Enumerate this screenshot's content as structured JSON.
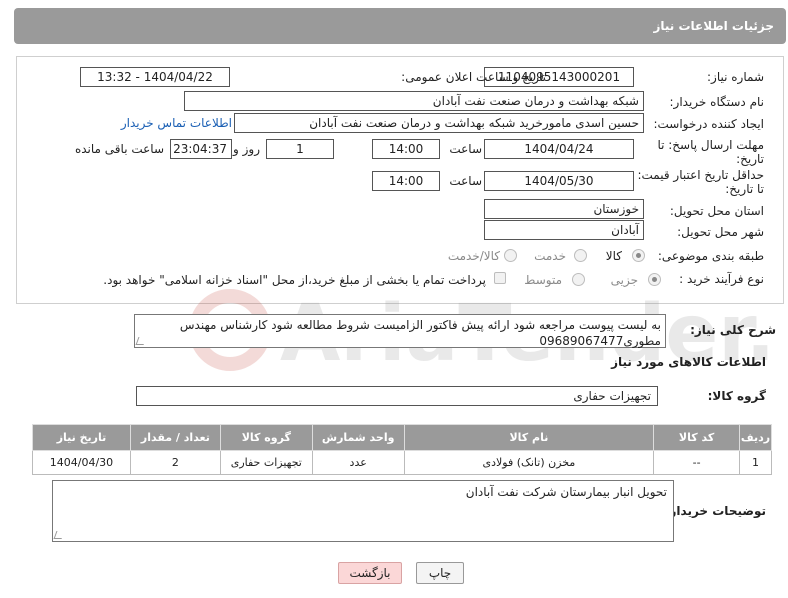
{
  "header": {
    "title": "جزئیات اطلاعات نیاز"
  },
  "form": {
    "need_number_label": "شماره نیاز:",
    "need_number": "1104095143000201",
    "announce_label": "تاریخ و ساعت اعلان عمومی:",
    "announce_value": "1404/04/22 - 13:32",
    "buyer_org_label": "نام دستگاه خریدار:",
    "buyer_org": "شبکه بهداشت و درمان صنعت نفت آبادان",
    "creator_label": "ایجاد کننده درخواست:",
    "creator": "حسین اسدی مامورخرید شبکه بهداشت و درمان صنعت نفت آبادان",
    "contact_link": "اطلاعات تماس خریدار",
    "deadline_label_1": "مهلت ارسال پاسخ: تا",
    "deadline_label_2": "تاریخ:",
    "deadline_date": "1404/04/24",
    "time_label": "ساعت",
    "deadline_time": "14:00",
    "days_value": "1",
    "days_label": "روز و",
    "remaining_time": "23:04:37",
    "remaining_label": "ساعت باقی مانده",
    "min_price_label_1": "حداقل تاریخ اعتبار قیمت:",
    "min_price_label_2": "تا تاریخ:",
    "validity_date": "1404/05/30",
    "validity_time": "14:00",
    "province_label": "استان محل تحویل:",
    "province": "خوزستان",
    "city_label": "شهر محل تحویل:",
    "city": "آبادان",
    "category_label": "طبقه بندی موضوعی:",
    "category_options": [
      "کالا",
      "خدمت",
      "کالا/خدمت"
    ],
    "category_selected": "کالا",
    "process_label": "نوع فرآیند خرید :",
    "process_options": [
      "جزیی",
      "متوسط"
    ],
    "process_selected": "جزیی",
    "payment_note": "پرداخت تمام یا بخشی از مبلغ خرید،از محل \"اسناد خزانه اسلامی\" خواهد بود."
  },
  "description": {
    "label": "شرح کلی نیاز:",
    "text": "به لیست پیوست مراجعه شود ارائه پیش فاکتور الزامیست شروط مطالعه شود کارشناس مهندس مطوری09689067477"
  },
  "goods": {
    "section_title": "اطلاعات کالاهای مورد نیاز",
    "group_label": "گروه کالا:",
    "group_value": "تجهیزات حفاری",
    "columns": [
      "ردیف",
      "کد کالا",
      "نام کالا",
      "واحد شمارش",
      "گروه کالا",
      "تعداد / مقدار",
      "تاریخ نیاز"
    ],
    "rows": [
      [
        "1",
        "--",
        "مخزن (تانک) فولادی",
        "عدد",
        "تجهیزات حفاری",
        "2",
        "1404/04/30"
      ]
    ]
  },
  "buyer_notes": {
    "label": "توضیحات خریدار:",
    "text": "تحویل انبار بیمارستان شرکت نفت آبادان"
  },
  "buttons": {
    "print": "چاپ",
    "back": "بازگشت"
  },
  "watermark": {
    "text": "AriaTender.neT"
  }
}
